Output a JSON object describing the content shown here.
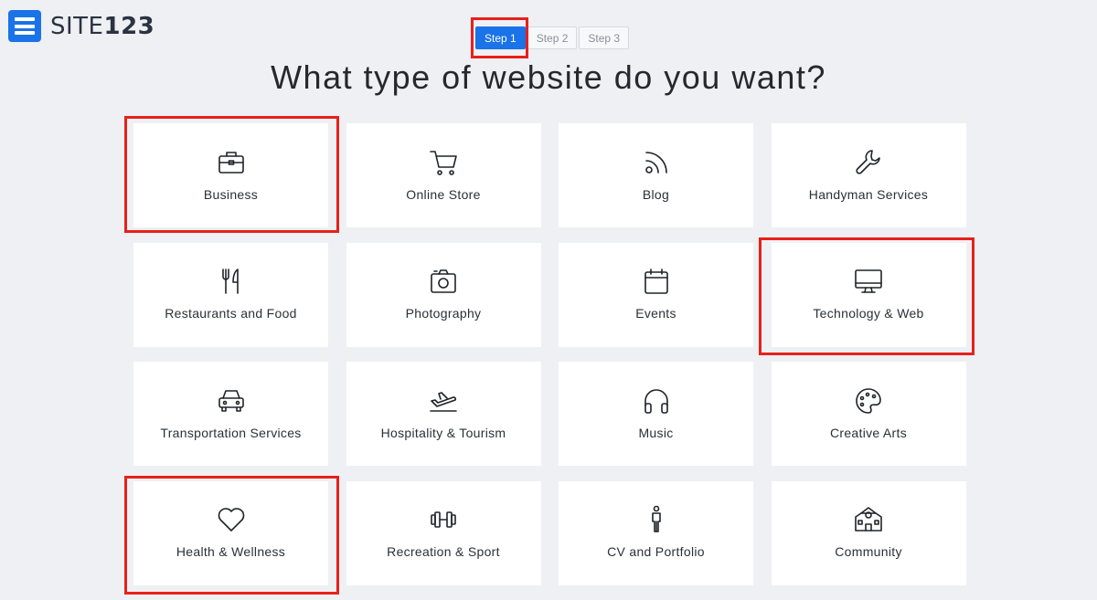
{
  "brand": {
    "name_light": "SITE",
    "name_bold": "123"
  },
  "steps": [
    {
      "label": "Step 1",
      "active": true
    },
    {
      "label": "Step 2",
      "active": false
    },
    {
      "label": "Step 3",
      "active": false
    }
  ],
  "title": "What type of website do you want?",
  "categories": [
    {
      "label": "Business",
      "icon": "briefcase-icon"
    },
    {
      "label": "Online Store",
      "icon": "cart-icon"
    },
    {
      "label": "Blog",
      "icon": "rss-icon"
    },
    {
      "label": "Handyman Services",
      "icon": "wrench-icon"
    },
    {
      "label": "Restaurants and Food",
      "icon": "fork-knife-icon"
    },
    {
      "label": "Photography",
      "icon": "camera-icon"
    },
    {
      "label": "Events",
      "icon": "calendar-icon"
    },
    {
      "label": "Technology & Web",
      "icon": "monitor-icon"
    },
    {
      "label": "Transportation Services",
      "icon": "car-icon"
    },
    {
      "label": "Hospitality & Tourism",
      "icon": "airplane-icon"
    },
    {
      "label": "Music",
      "icon": "headphones-icon"
    },
    {
      "label": "Creative Arts",
      "icon": "palette-icon"
    },
    {
      "label": "Health & Wellness",
      "icon": "heart-icon"
    },
    {
      "label": "Recreation & Sport",
      "icon": "dumbbell-icon"
    },
    {
      "label": "CV and Portfolio",
      "icon": "person-icon"
    },
    {
      "label": "Community",
      "icon": "building-icon"
    }
  ],
  "highlight_color": "#e8201a",
  "accent_color": "#1a73e8"
}
